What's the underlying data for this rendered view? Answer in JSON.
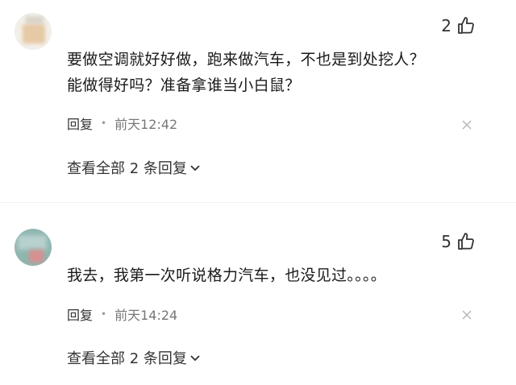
{
  "comments": [
    {
      "like_count": "2",
      "text_lines": [
        "要做空调就好好做，跑来做汽车，不也是到处挖人？",
        "能做得好吗？准备拿谁当小白鼠？"
      ],
      "reply_label": "回复",
      "time": "前天12:42",
      "view_replies": "查看全部 2 条回复"
    },
    {
      "like_count": "5",
      "text_lines": [
        "我去，我第一次听说格力汽车，也没见过。。。。"
      ],
      "reply_label": "回复",
      "time": "前天14:24",
      "view_replies": "查看全部 2 条回复"
    }
  ],
  "icons": {
    "like": "thumbs-up-icon",
    "close": "close-icon",
    "expand": "chevron-down-icon"
  },
  "colors": {
    "text": "#1a1a1a",
    "muted": "#777777",
    "divider": "#f1f1f1"
  }
}
